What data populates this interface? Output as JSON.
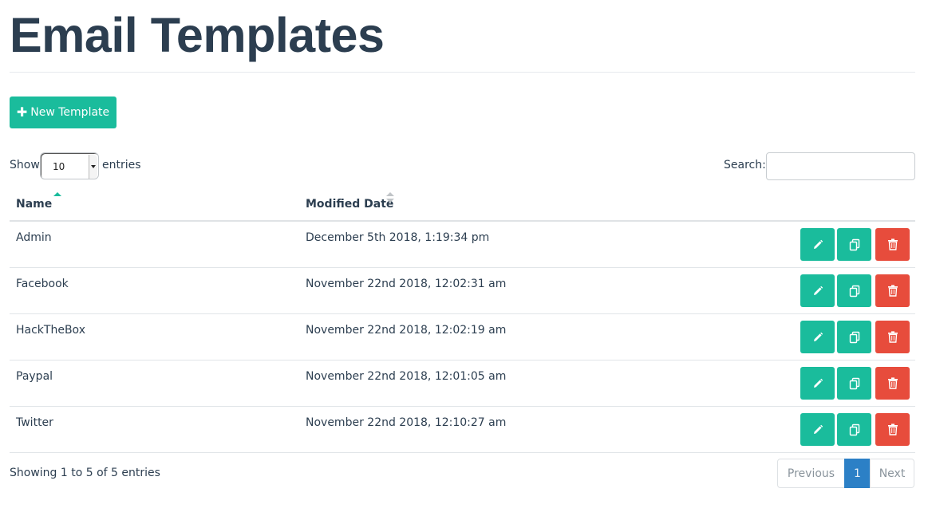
{
  "page": {
    "title": "Email Templates"
  },
  "toolbar": {
    "new_label": "New Template",
    "new_icon": "plus-icon"
  },
  "length": {
    "show_label": "Show",
    "value": "10",
    "entries_label": "entries"
  },
  "search": {
    "label": "Search:",
    "value": "",
    "placeholder": ""
  },
  "table": {
    "headers": {
      "name": "Name",
      "modified": "Modified Date"
    },
    "rows": [
      {
        "name": "Admin",
        "modified": "December 5th 2018, 1:19:34 pm"
      },
      {
        "name": "Facebook",
        "modified": "November 22nd 2018, 12:02:31 am"
      },
      {
        "name": "HackTheBox",
        "modified": "November 22nd 2018, 12:02:19 am"
      },
      {
        "name": "Paypal",
        "modified": "November 22nd 2018, 12:01:05 am"
      },
      {
        "name": "Twitter",
        "modified": "November 22nd 2018, 12:10:27 am"
      }
    ],
    "row_actions": [
      "pencil-icon",
      "copy-icon",
      "trash-icon"
    ]
  },
  "footer": {
    "info": "Showing 1 to 5 of 5 entries",
    "previous": "Previous",
    "current_page": "1",
    "next": "Next"
  },
  "colors": {
    "primary": "#1abc9c",
    "danger": "#e74c3c",
    "text": "#2c3e50",
    "active_page": "#2c80c6"
  }
}
